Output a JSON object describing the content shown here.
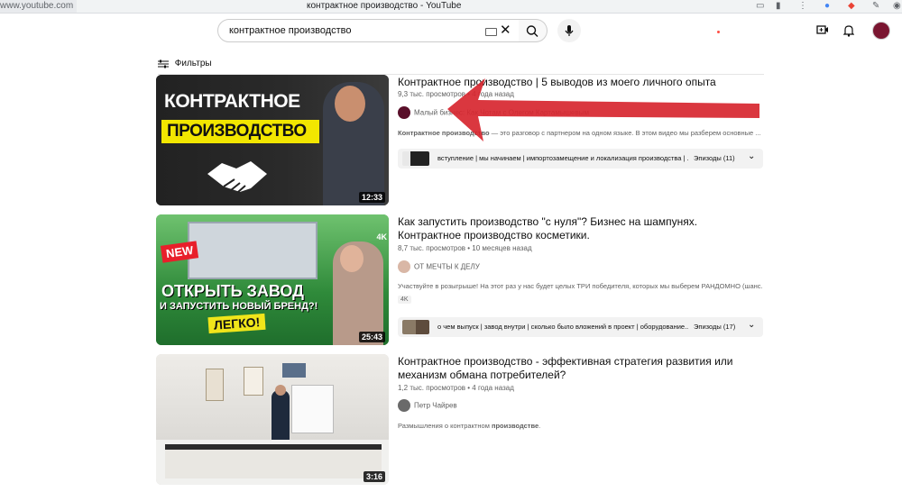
{
  "browser": {
    "url": "www.youtube.com",
    "window_title": "контрактное производство - YouTube"
  },
  "search": {
    "query": "контрактное производство"
  },
  "filters_label": "Фильтры",
  "colors": {
    "arrow": "#d7262f",
    "accent_red": "#ff0000"
  },
  "videos": [
    {
      "title_line1": "Контрактное производство | 5 выводов из моего личного опыта",
      "title_line2": "",
      "views": "9,3 тыс. просмотров",
      "age": "4 года назад",
      "channel": "Малый бизнес: Как Чотам с Олегом Картамышевым",
      "desc_bold": "Контрактное производство",
      "desc_rest": " — это разговор с партнером на одном языке. В этом видео мы разберем основные ...",
      "duration": "12:33",
      "thumb_text1": "КОНТРАКТНОЕ",
      "thumb_text2": "ПРОИЗВОДСТВО",
      "chapters_text": "вступление | мы начинаем | импортозамещение и локализация производства | ...",
      "chapters_count": "Эпизоды (11)"
    },
    {
      "title_line1": "Как запустить производство \"с нуля\"? Бизнес на шампунях.",
      "title_line2": "Контрактное производство косметики.",
      "views": "8,7 тыс. просмотров",
      "age": "10 месяцев назад",
      "channel": "ОТ МЕЧТЫ К ДЕЛУ",
      "desc_bold": "",
      "desc_rest": "Участвуйте в розыгрыше! На этот раз у нас будет целых ТРИ победителя, которых мы выберем РАНДОМНО (шанс...",
      "badge": "4K",
      "duration": "25:43",
      "thumb_new": "NEW",
      "thumb_text1": "ОТКРЫТЬ ЗАВОД",
      "thumb_text2": "И ЗАПУСТИТЬ НОВЫЙ БРЕНД?!",
      "thumb_text3": "ЛЕГКО!",
      "chapters_text": "о чем выпуск | завод внутри | сколько было вложений в проект | оборудование...",
      "chapters_count": "Эпизоды (17)"
    },
    {
      "title_line1": "Контрактное производство - эффективная стратегия развития или",
      "title_line2": "механизм обмана потребителей?",
      "views": "1,2 тыс. просмотров",
      "age": "4 года назад",
      "channel": "Петр Чайрев",
      "desc_rest_pre": "Размышления о контрактном ",
      "desc_bold": "производстве",
      "desc_rest": ".",
      "duration": "3:16"
    }
  ]
}
